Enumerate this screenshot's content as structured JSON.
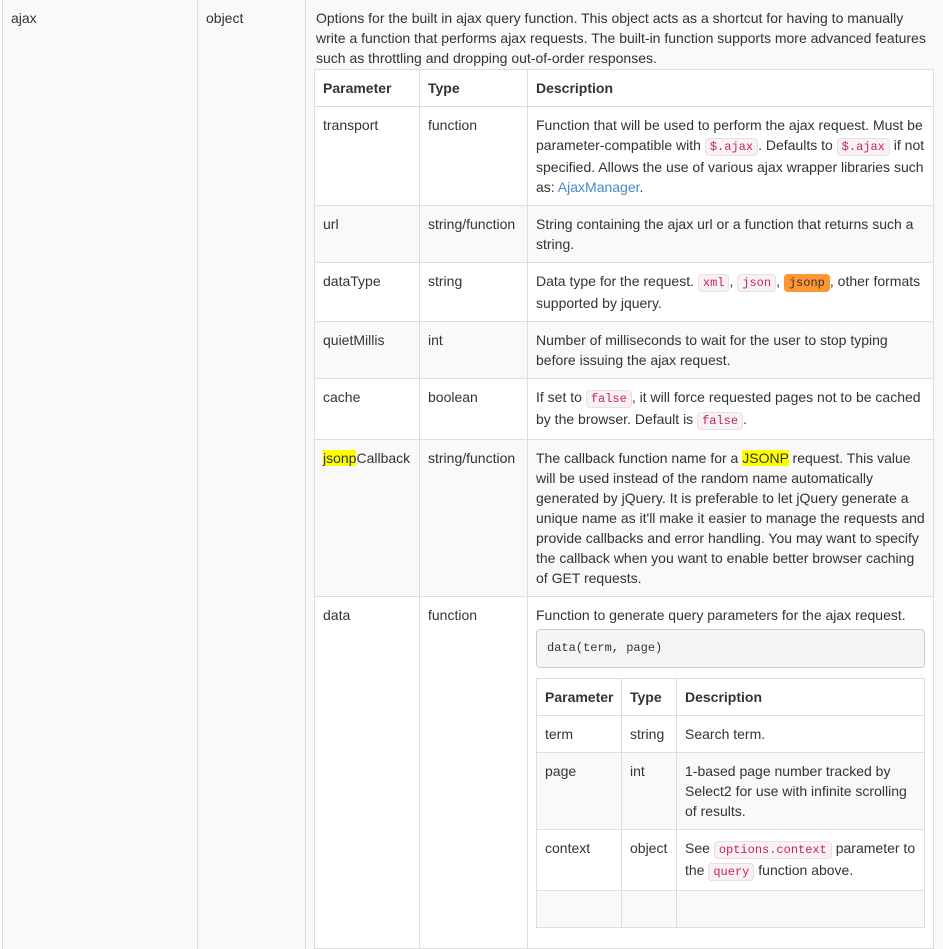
{
  "option": {
    "name": "ajax",
    "type": "object",
    "description": "Options for the built in ajax query function. This object acts as a shortcut for having to manually write a function that performs ajax requests. The built-in function supports more advanced features such as throttling and dropping out-of-order responses."
  },
  "params_table": {
    "headers": [
      "Parameter",
      "Type",
      "Description"
    ],
    "transport": {
      "name": "transport",
      "type": "function",
      "desc_1": "Function that will be used to perform the ajax request. Must be parameter-compatible with ",
      "code_1": "$.ajax",
      "desc_2": ". Defaults to ",
      "code_2": "$.ajax",
      "desc_3": " if not specified. Allows the use of various ajax wrapper libraries such as: ",
      "link": "AjaxManager",
      "desc_4": "."
    },
    "url": {
      "name": "url",
      "type": "string/function",
      "desc": "String containing the ajax url or a function that returns such a string."
    },
    "dataType": {
      "name": "dataType",
      "type": "string",
      "desc_1": "Data type for the request. ",
      "code_xml": "xml",
      "sep_1": ", ",
      "code_json": "json",
      "sep_2": ", ",
      "code_jsonp": "jsonp",
      "desc_2": ", other formats supported by jquery."
    },
    "quietMillis": {
      "name": "quietMillis",
      "type": "int",
      "desc": "Number of milliseconds to wait for the user to stop typing before issuing the ajax request."
    },
    "cache": {
      "name": "cache",
      "type": "boolean",
      "desc_1": "If set to ",
      "code_1": "false",
      "desc_2": ", it will force requested pages not to be cached by the browser. Default is ",
      "code_2": "false",
      "desc_3": "."
    },
    "jsonpCallback": {
      "name_highlight": "jsonp",
      "name_rest": "Callback",
      "type": "string/function",
      "desc_1": "The callback function name for a ",
      "highlight": "JSONP",
      "desc_2": " request. This value will be used instead of the random name automatically generated by jQuery. It is preferable to let jQuery generate a unique name as it'll make it easier to manage the requests and provide callbacks and error handling. You may want to specify the callback when you want to enable better browser caching of GET requests."
    },
    "data": {
      "name": "data",
      "type": "function",
      "desc": "Function to generate query parameters for the ajax request.",
      "code_sample": "data(term, page)",
      "nested": {
        "headers": [
          "Parameter",
          "Type",
          "Description"
        ],
        "term": {
          "name": "term",
          "type": "string",
          "desc": "Search term."
        },
        "page": {
          "name": "page",
          "type": "int",
          "desc": "1-based page number tracked by Select2 for use with infinite scrolling of results."
        },
        "context": {
          "name": "context",
          "type": "object",
          "desc_1": "See ",
          "code_1": "options.context",
          "desc_2": " parameter to the ",
          "code_2": "query",
          "desc_3": " function above."
        }
      }
    }
  }
}
